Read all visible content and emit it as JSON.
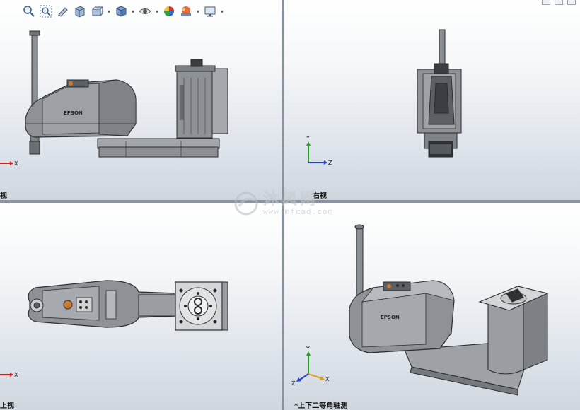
{
  "toolbar": {
    "buttons": [
      {
        "name": "zoom-to-fit-icon",
        "caret": false
      },
      {
        "name": "zoom-to-area-icon",
        "caret": false
      },
      {
        "name": "previous-view-icon",
        "caret": false
      },
      {
        "name": "section-view-icon",
        "caret": false
      },
      {
        "name": "dynamic-annotation-icon",
        "caret": true
      },
      {
        "name": "view-orientation-icon",
        "caret": true
      },
      {
        "name": "display-style-icon",
        "caret": true
      },
      {
        "name": "hide-show-items-icon",
        "caret": true
      },
      {
        "name": "edit-appearance-icon",
        "caret": false
      },
      {
        "name": "apply-scene-icon",
        "caret": true
      },
      {
        "name": "view-settings-icon",
        "caret": true
      }
    ]
  },
  "views": {
    "top_left": {
      "label": "视"
    },
    "top_right": {
      "label": "右视"
    },
    "bottom_left": {
      "label": "上视"
    },
    "bottom_right": {
      "label": "*上下二等角轴测"
    }
  },
  "robot": {
    "brand": "EPSON"
  },
  "triad": {
    "x": "X",
    "y": "Y",
    "z": "Z"
  },
  "watermark": {
    "cn": "沐风网",
    "url": "www.mfcad.com"
  },
  "colors": {
    "body": "#8e9296",
    "body_dark": "#5c6064",
    "outline": "#2a2c2e",
    "axis_x": "#d22020",
    "axis_y": "#2a9a2a",
    "axis_z": "#2a3fd0"
  }
}
